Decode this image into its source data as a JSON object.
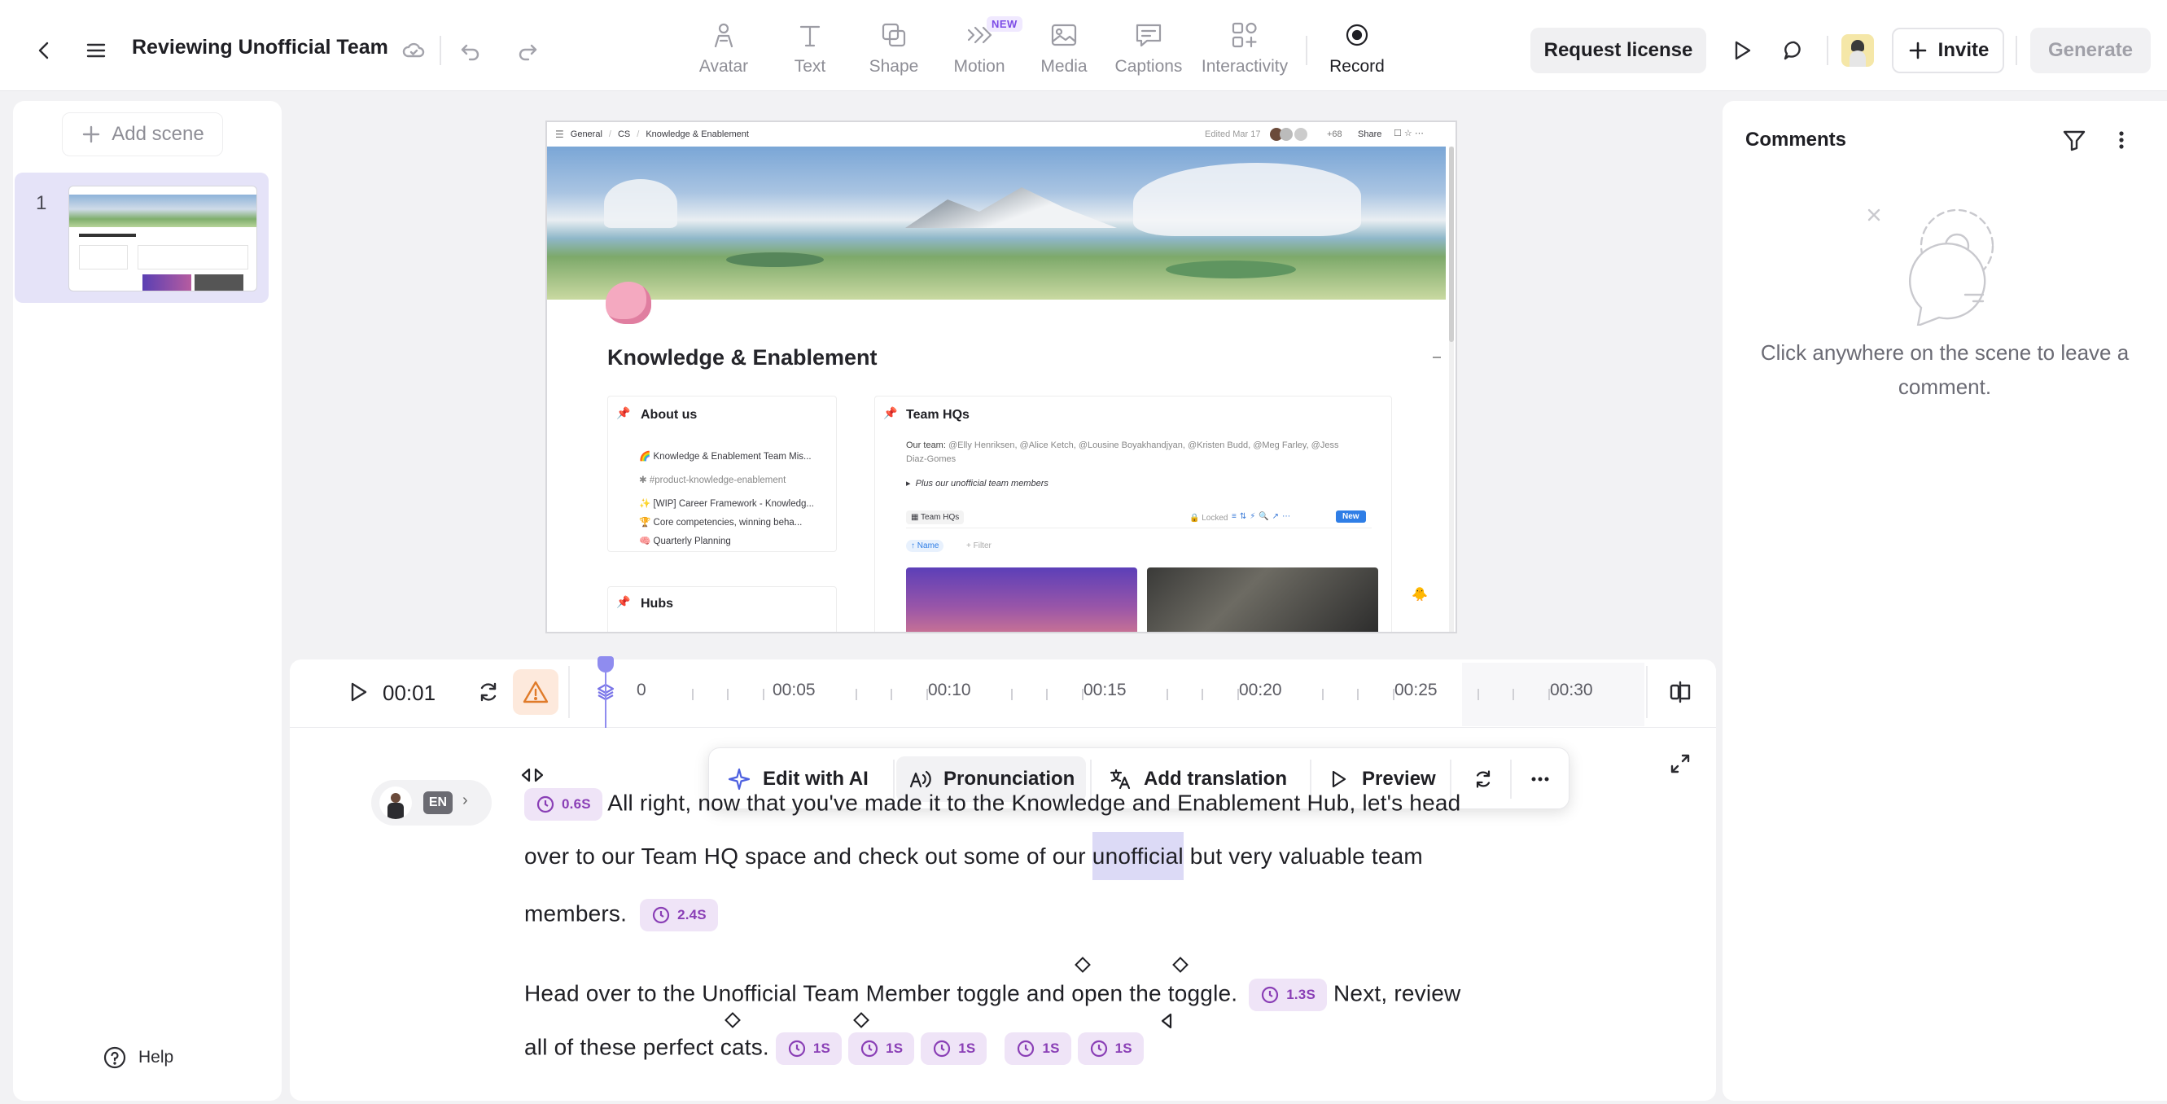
{
  "header": {
    "title": "Reviewing Unofficial Team",
    "tools": [
      {
        "label": "Avatar",
        "icon": "avatar-icon"
      },
      {
        "label": "Text",
        "icon": "text-icon"
      },
      {
        "label": "Shape",
        "icon": "shape-icon"
      },
      {
        "label": "Motion",
        "icon": "motion-icon",
        "badge": "NEW"
      },
      {
        "label": "Media",
        "icon": "media-icon"
      },
      {
        "label": "Captions",
        "icon": "captions-icon"
      },
      {
        "label": "Interactivity",
        "icon": "interactivity-icon"
      },
      {
        "label": "Record",
        "icon": "record-icon"
      }
    ],
    "request_license": "Request license",
    "invite": "Invite",
    "generate": "Generate"
  },
  "sidebar": {
    "add_scene": "Add scene",
    "scenes": [
      {
        "number": "1"
      }
    ],
    "help": "Help"
  },
  "scene": {
    "breadcrumb": [
      "General",
      "CS",
      "Knowledge & Enablement"
    ],
    "edited": "Edited Mar 17",
    "viewer_count": "+68",
    "share": "Share",
    "page_title": "Knowledge & Enablement",
    "about": {
      "heading": "About us",
      "items": [
        "Knowledge & Enablement Team Mis...",
        "#product-knowledge-enablement",
        "[WIP] Career Framework - Knowledg...",
        "Core competencies, winning beha...",
        "Quarterly Planning"
      ]
    },
    "hubs": {
      "heading": "Hubs"
    },
    "team": {
      "heading": "Team HQs",
      "our_team_label": "Our team:",
      "members": "@Elly Henriksen, @Alice Ketch, @Lousine Boyakhandjyan, @Kristen Budd, @Meg Farley, @Jess Diaz-Gomes",
      "toggle": "Plus our unofficial team members",
      "db_title": "Team HQs",
      "locked": "Locked",
      "new": "New",
      "sort": "Name",
      "filter": "+ Filter"
    }
  },
  "timeline": {
    "time": "00:01",
    "ticks": [
      "0",
      "00:05",
      "00:10",
      "00:15",
      "00:20",
      "00:25",
      "00:30"
    ]
  },
  "floating_toolbar": {
    "edit_ai": "Edit with AI",
    "pronunciation": "Pronunciation",
    "add_translation": "Add translation",
    "preview": "Preview"
  },
  "script": {
    "language": "EN",
    "line1_pause": "0.6S",
    "line1_text": "All right, now that you've made it to the Knowledge and Enablement Hub, let's head",
    "line2_before": "over to our Team HQ space and check out some of our ",
    "line2_highlight": "unofficial",
    "line2_after": " but very valuable team",
    "line3_text": "members.",
    "line3_pause": "2.4S",
    "line4_text": "Head over to the Unofficial Team Member toggle and open the toggle.",
    "line4_pause": "1.3S",
    "line4_after": "Next, review",
    "line5_text": "all of these perfect cats.",
    "line5_pauses": [
      "1S",
      "1S",
      "1S",
      "1S",
      "1S"
    ]
  },
  "comments": {
    "title": "Comments",
    "empty_text": "Click anywhere on the scene to leave a comment."
  }
}
